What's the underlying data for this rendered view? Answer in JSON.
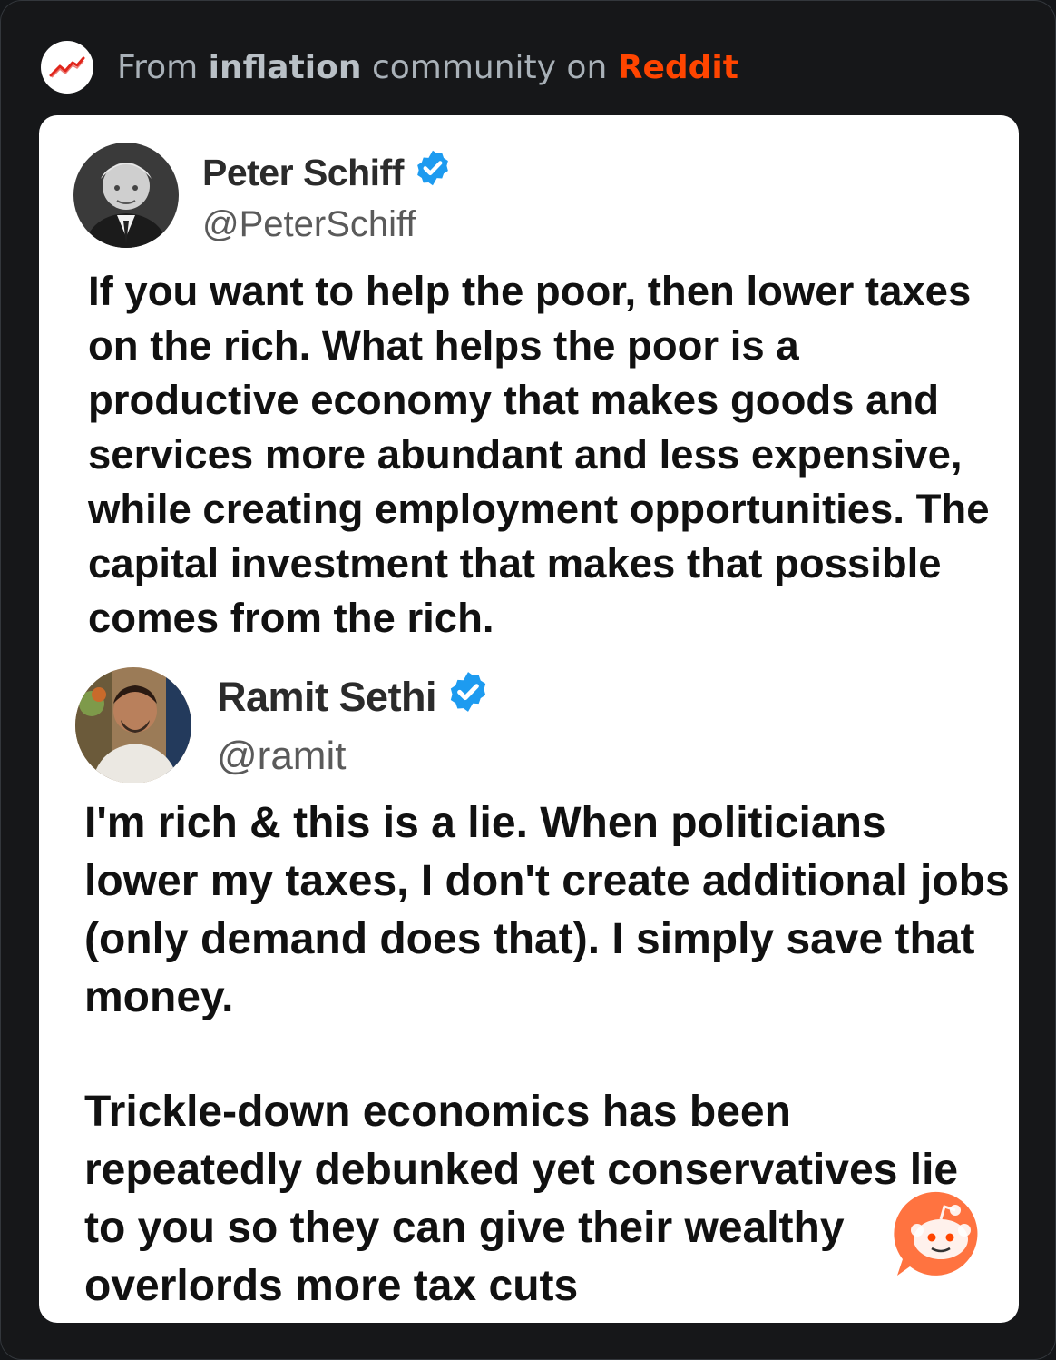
{
  "header": {
    "icon": "trending-line-icon",
    "prefix": "From",
    "community": "inflation",
    "middle": "community on",
    "platform": "Reddit",
    "platform_color": "#ff4500"
  },
  "tweets": [
    {
      "display_name": "Peter Schiff",
      "handle": "@PeterSchiff",
      "verified": true,
      "text": "If you want to help the poor, then lower taxes on the rich. What helps the poor is a productive economy that makes goods and services more abundant and less expensive, while creating employment opportunities. The capital investment that makes that possible comes from the rich."
    },
    {
      "display_name": "Ramit Sethi",
      "handle": "@ramit",
      "verified": true,
      "text": "I'm rich & this is a lie. When politicians lower my taxes, I don't create additional jobs (only demand does that). I simply save that money.",
      "text_2": "Trickle-down economics has been repeatedly debunked yet conservatives lie to you so they can give their wealthy overlords more tax cuts"
    }
  ],
  "colors": {
    "verified": "#1d9bf0",
    "background": "#161719"
  }
}
